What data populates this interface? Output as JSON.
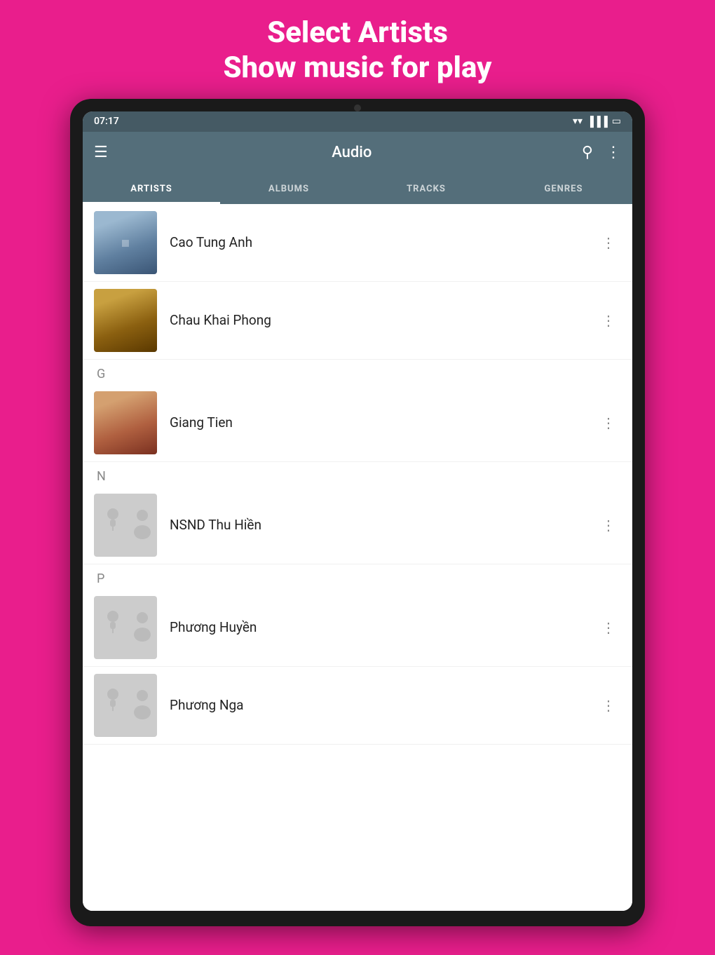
{
  "promo": {
    "line1": "Select Artists",
    "line2": "Show music for play"
  },
  "status_bar": {
    "time": "07:17",
    "wifi": "wifi",
    "signal": "signal",
    "battery": "battery"
  },
  "app_bar": {
    "title": "Audio",
    "menu_label": "menu",
    "search_label": "search",
    "more_label": "more"
  },
  "tabs": [
    {
      "id": "artists",
      "label": "ARTISTS",
      "active": true
    },
    {
      "id": "albums",
      "label": "ALBUMS",
      "active": false
    },
    {
      "id": "tracks",
      "label": "TRACKS",
      "active": false
    },
    {
      "id": "genres",
      "label": "GENRES",
      "active": false
    }
  ],
  "sections": [
    {
      "letter": "",
      "artists": [
        {
          "id": "cao-tung-anh",
          "name": "Cao Tung Anh",
          "has_photo": true,
          "art_class": "art-cao"
        },
        {
          "id": "chau-khai-phong",
          "name": "Chau Khai Phong",
          "has_photo": true,
          "art_class": "art-chau"
        }
      ]
    },
    {
      "letter": "G",
      "artists": [
        {
          "id": "giang-tien",
          "name": "Giang Tien",
          "has_photo": true,
          "art_class": "art-giang"
        }
      ]
    },
    {
      "letter": "N",
      "artists": [
        {
          "id": "nsnd-thu-hien",
          "name": "NSND Thu Hiền",
          "has_photo": false,
          "art_class": ""
        }
      ]
    },
    {
      "letter": "P",
      "artists": [
        {
          "id": "phuong-huyen",
          "name": "Phương Huyền",
          "has_photo": false,
          "art_class": ""
        },
        {
          "id": "phuong-nga",
          "name": "Phương Nga",
          "has_photo": false,
          "art_class": ""
        }
      ]
    }
  ]
}
